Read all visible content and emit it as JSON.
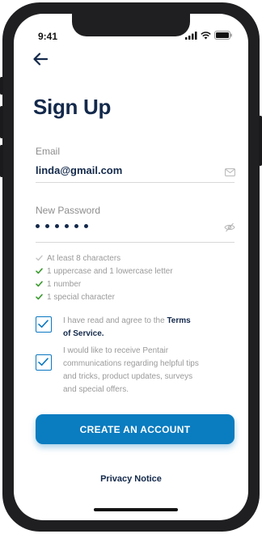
{
  "status_bar": {
    "time": "9:41"
  },
  "page": {
    "title": "Sign Up"
  },
  "email": {
    "label": "Email",
    "value": "linda@gmail.com"
  },
  "password": {
    "label": "New Password",
    "masked_length": 6
  },
  "requirements": [
    {
      "text": "At least 8 characters",
      "met": false
    },
    {
      "text": "1 uppercase and 1 lowercase letter",
      "met": true
    },
    {
      "text": "1 number",
      "met": true
    },
    {
      "text": "1 special character",
      "met": true
    }
  ],
  "terms": {
    "text_prefix": "I have read and agree to the",
    "link_line1": "Terms",
    "link_line2": "of Service.",
    "checked": true
  },
  "marketing": {
    "line1": "I would like to receive Pentair",
    "line2": "communications regarding helpful tips",
    "line3": "and tricks, product updates, surveys",
    "line4": "and special offers.",
    "checked": true
  },
  "cta": {
    "label": "CREATE AN ACCOUNT"
  },
  "footer": {
    "privacy_label": "Privacy Notice"
  },
  "colors": {
    "brand_navy": "#13294b",
    "accent_blue": "#0a7cc0",
    "check_green": "#3a9a2e",
    "muted_text": "#9a9a9a"
  },
  "icons": {
    "back": "arrow-left-icon",
    "email": "envelope-icon",
    "password": "eye-slash-icon",
    "status": [
      "signal-icon",
      "wifi-icon",
      "battery-icon"
    ]
  }
}
